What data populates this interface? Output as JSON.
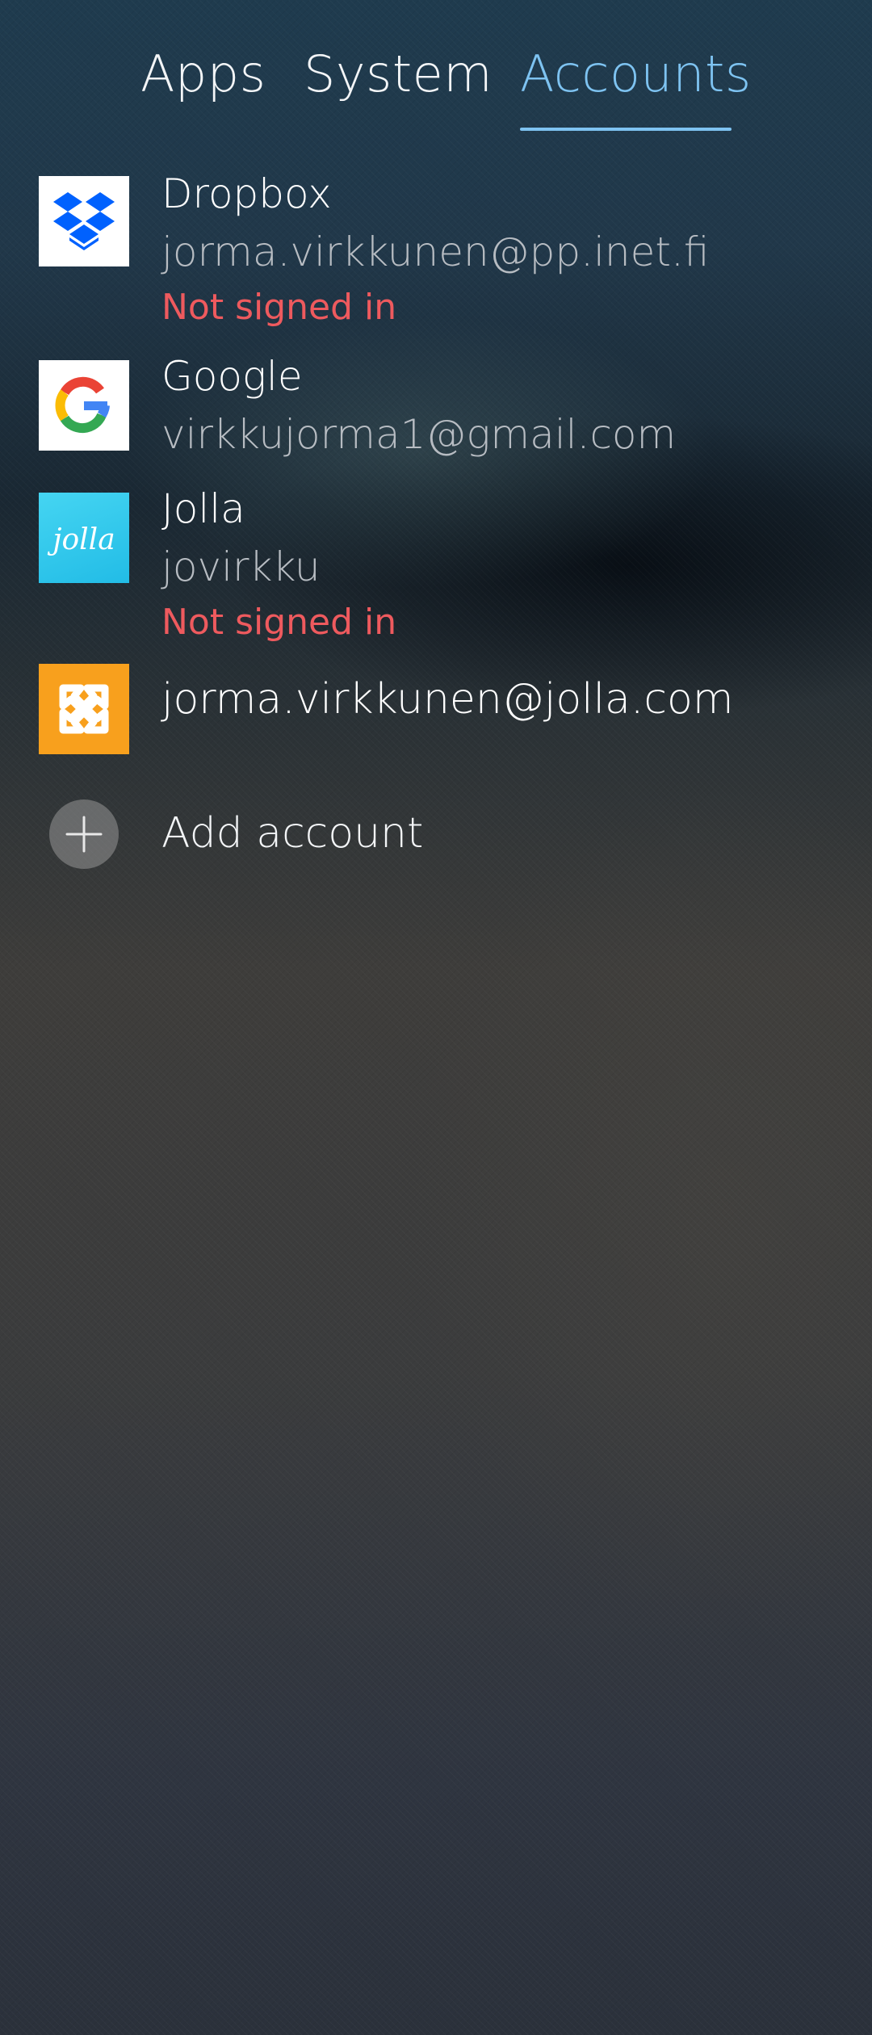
{
  "tabs": {
    "items": [
      {
        "label": "Apps"
      },
      {
        "label": "System"
      },
      {
        "label": "Accounts"
      }
    ],
    "active_color": "#7ec3f1"
  },
  "accounts": [
    {
      "name": "Dropbox",
      "user": "jorma.virkkunen@pp.inet.fi",
      "status": "Not signed in",
      "icon": "dropbox-icon"
    },
    {
      "name": "Google",
      "user": "virkkujorma1@gmail.com",
      "icon": "google-icon"
    },
    {
      "name": "Jolla",
      "user": "jovirkku",
      "status": "Not signed in",
      "icon": "jolla-icon",
      "icon_text": "jolla"
    },
    {
      "name": "jorma.virkkunen@jolla.com",
      "icon": "exchange-icon"
    }
  ],
  "add_account": {
    "label": "Add account",
    "icon": "plus-icon"
  },
  "colors": {
    "status_error": "#ee5a5e",
    "secondary_text": "#b7bcc2",
    "dropbox_blue": "#0061fe",
    "exchange_orange": "#f8a01d",
    "jolla_cyan": "#22bce6"
  }
}
